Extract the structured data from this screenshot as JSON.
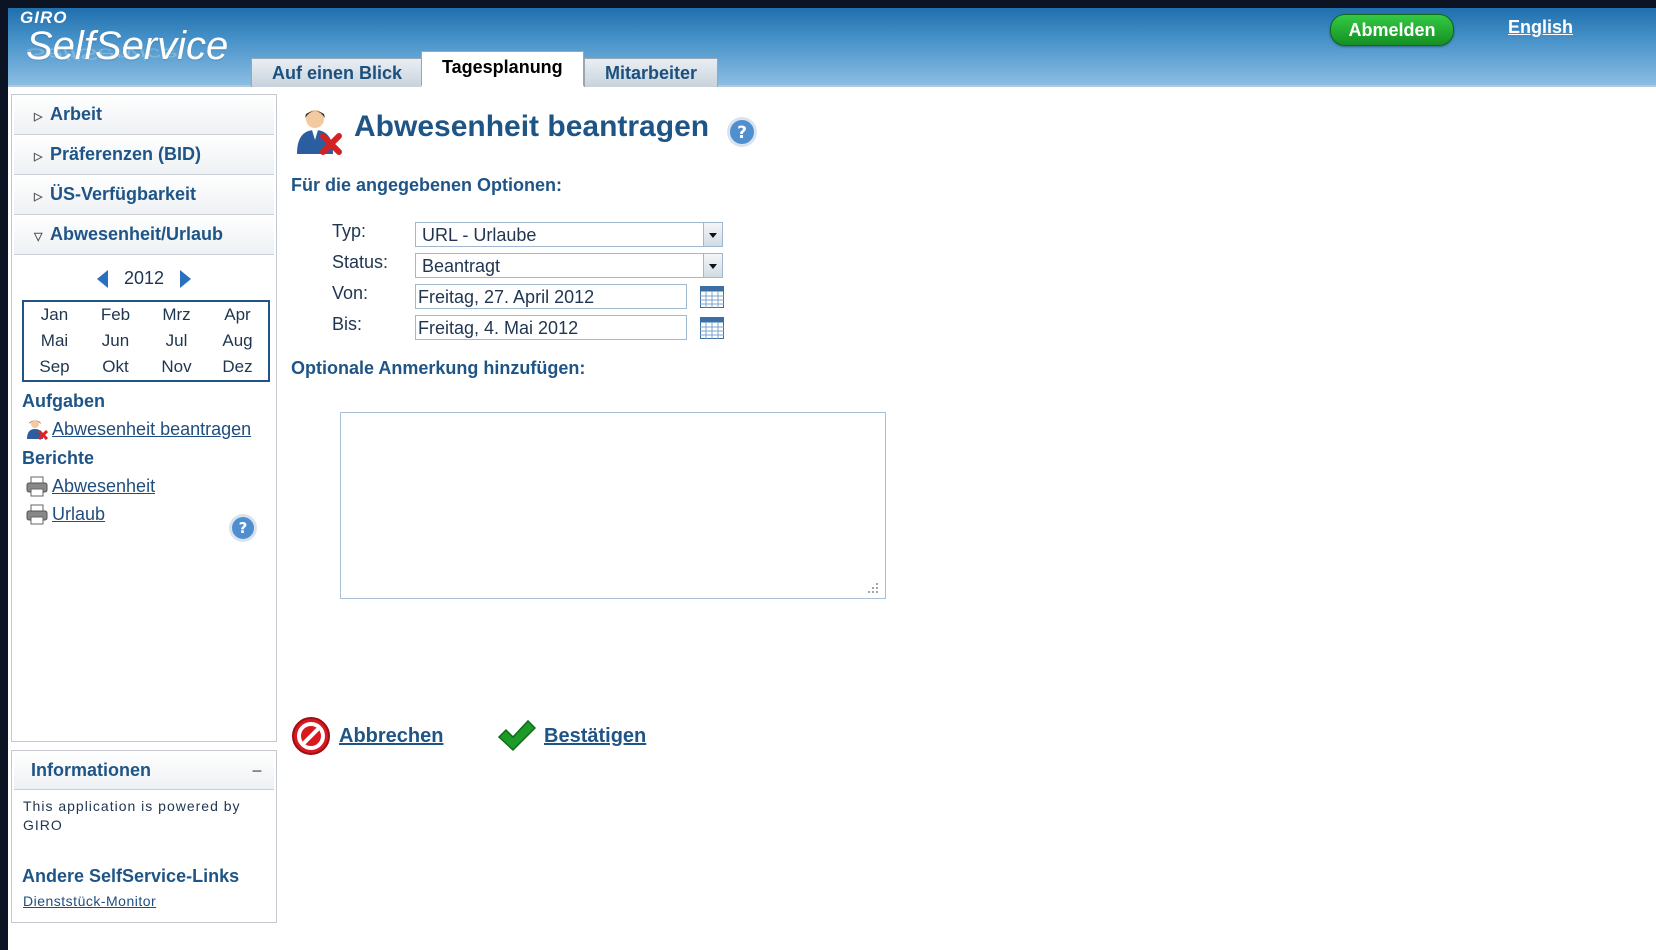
{
  "header": {
    "brand_small": "GIRO",
    "brand_big": "SelfService",
    "tabs": [
      {
        "label": "Auf einen Blick"
      },
      {
        "label": "Tagesplanung"
      },
      {
        "label": "Mitarbeiter"
      }
    ],
    "logout_label": "Abmelden",
    "language_link": "English"
  },
  "sidebar": {
    "sections": [
      {
        "label": "Arbeit"
      },
      {
        "label": "Präferenzen (BID)"
      },
      {
        "label": "ÜS-Verfügbarkeit"
      },
      {
        "label": "Abwesenheit/Urlaub"
      }
    ],
    "year": "2012",
    "months": [
      "Jan",
      "Feb",
      "Mrz",
      "Apr",
      "Mai",
      "Jun",
      "Jul",
      "Aug",
      "Sep",
      "Okt",
      "Nov",
      "Dez"
    ],
    "tasks_heading": "Aufgaben",
    "tasks": [
      {
        "label": "Abwesenheit beantragen",
        "icon": "user-absence-icon"
      }
    ],
    "reports_heading": "Berichte",
    "reports": [
      {
        "label": "Abwesenheit",
        "icon": "printer-icon"
      },
      {
        "label": "Urlaub",
        "icon": "printer-icon"
      }
    ]
  },
  "info": {
    "heading": "Informationen",
    "minimize": "–",
    "text": "This application is powered by GIRO",
    "other_heading": "Andere SelfService-Links",
    "other_link": "Dienststück-Monitor"
  },
  "main": {
    "title": "Abwesenheit beantragen",
    "options_heading": "Für die angegebenen Optionen:",
    "fields": {
      "typ_label": "Typ:",
      "typ_value": "URL - Urlaube",
      "status_label": "Status:",
      "status_value": "Beantragt",
      "von_label": "Von:",
      "von_value": "Freitag, 27. April 2012",
      "bis_label": "Bis:",
      "bis_value": "Freitag, 4. Mai 2012"
    },
    "note_heading": "Optionale Anmerkung hinzufügen:",
    "note_value": "",
    "cancel_label": "Abbrechen",
    "confirm_label": "Bestätigen"
  },
  "colors": {
    "accent": "#1f5586",
    "logout_green": "#1fa42f",
    "header_blue": "#3b86c2"
  }
}
